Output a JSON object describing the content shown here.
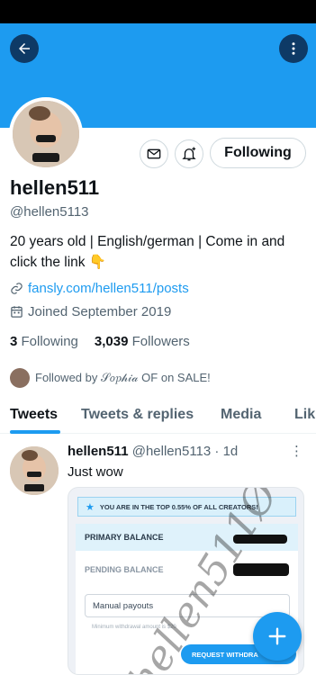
{
  "profile": {
    "display_name": "hellen511",
    "handle": "@hellen5113",
    "bio": "20 years old | English/german | Come in and click the link 👇",
    "link": "fansly.com/hellen511/posts",
    "joined": "Joined September 2019",
    "following_count": "3",
    "following_label": "Following",
    "followers_count": "3,039",
    "followers_label": "Followers",
    "followed_by": "Followed by 𝒮𝑜𝑝𝒽𝒾𝒶 OF on SALE!"
  },
  "actions": {
    "follow_label": "Following"
  },
  "tabs": [
    {
      "label": "Tweets",
      "active": true
    },
    {
      "label": "Tweets & replies",
      "active": false
    },
    {
      "label": "Media",
      "active": false
    },
    {
      "label": "Lik",
      "active": false
    }
  ],
  "tweet": {
    "author": "hellen511",
    "handle": "@hellen5113",
    "time": "· 1d",
    "text": "Just wow",
    "media": {
      "top_banner": "YOU ARE IN THE TOP 0.55% OF ALL CREATORS!",
      "primary_balance": "PRIMARY BALANCE",
      "pending_balance": "PENDING BALANCE",
      "payout_select": "Manual payouts",
      "note": "Minimum withdrawal amount is $20",
      "withdraw_button": "REQUEST WITHDRA",
      "watermark": "hellen511Ø"
    }
  },
  "colors": {
    "brand": "#1d9bf0",
    "banner": "#1d9bf0",
    "text": "#0f1419",
    "secondary": "#536471"
  },
  "icons": {
    "back": "arrow-left-icon",
    "more": "more-vertical-icon",
    "message": "mail-icon",
    "notify": "bell-plus-icon",
    "link": "link-icon",
    "calendar": "calendar-icon",
    "compose": "plus-icon"
  }
}
